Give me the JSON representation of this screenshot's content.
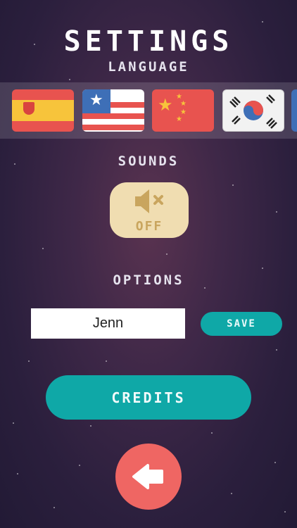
{
  "screen": {
    "title": "SETTINGS"
  },
  "language": {
    "label": "LANGUAGE",
    "flags": [
      {
        "name": "spain",
        "icon": "spain-flag-icon"
      },
      {
        "name": "usa",
        "icon": "us-flag-icon"
      },
      {
        "name": "china",
        "icon": "china-flag-icon"
      },
      {
        "name": "korea",
        "icon": "korea-flag-icon"
      },
      {
        "name": "partial-next",
        "icon": "flag-icon"
      }
    ]
  },
  "sounds": {
    "label": "SOUNDS",
    "state_label": "OFF",
    "icon": "speaker-muted-icon"
  },
  "options": {
    "label": "OPTIONS",
    "name_value": "Jenn",
    "save_label": "SAVE"
  },
  "credits": {
    "label": "CREDITS"
  },
  "back": {
    "icon": "back-arrow-icon"
  },
  "colors": {
    "teal": "#0fa8a7",
    "coral": "#ef6663",
    "sound_bg": "#f0ddb1",
    "sound_fg": "#c9a55e"
  }
}
